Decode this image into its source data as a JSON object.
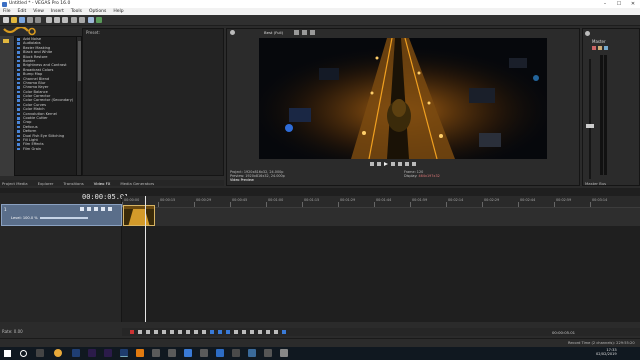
{
  "window": {
    "title": "Untitled * - VEGAS Pro 16.0",
    "controls": [
      "–",
      "☐",
      "✕"
    ]
  },
  "menu": [
    "File",
    "Edit",
    "View",
    "Insert",
    "Tools",
    "Options",
    "Help"
  ],
  "explorer": {
    "presets_label": "Preset:",
    "effects": [
      "Add Noise",
      "Audiolabs",
      "Bezier Masking",
      "Black and White",
      "Block Restore",
      "Border",
      "Brightness and Contrast",
      "Broadcast Colors",
      "Bump Map",
      "Channel Blend",
      "Chroma Blur",
      "Chroma Keyer",
      "Color Balance",
      "Color Corrector",
      "Color Corrector (Secondary)",
      "Color Curves",
      "Color Match",
      "Convolution Kernel",
      "Cookie Cutter",
      "Crop",
      "Defocus",
      "Deform",
      "Dual Fish Eye Stitching",
      "Fill Light",
      "Film Effects",
      "Film Grain"
    ],
    "tabs": [
      "Project Media",
      "Explorer",
      "Transitions",
      "Video FX",
      "Media Generators"
    ]
  },
  "preview": {
    "mode": "Best (Full)",
    "tab": "Video Preview",
    "project_line": "Project:   1920x816x32, 24.000p",
    "preview_line": "Preview:   1920x816x32, 24.000p",
    "display_line": "Video Preview",
    "frame_label": "Frame:",
    "frame_value": "120",
    "display_label": "Display:",
    "display_value": "464x197x32"
  },
  "mixer": {
    "title": "Master",
    "tab": "Master Bus"
  },
  "timeline": {
    "timecode": "00:00:05.01",
    "track_level": "Level: 100.0 %",
    "track_number": "1",
    "ruler_marks": [
      "00:00:00",
      "00:00:15",
      "00:00:29",
      "00:00:45",
      "00:01:00",
      "00:01:15",
      "00:01:29",
      "00:01:44",
      "00:01:59",
      "00:02:14",
      "00:02:29",
      "00:02:44",
      "00:02:59",
      "00:03:14"
    ]
  },
  "bottom": {
    "rate": "Rate: 0.00",
    "end_time": "00:00:05.01",
    "record_time": "Record Time (2 channels): 229:55:20"
  },
  "taskbar": {
    "time": "17:33",
    "date": "02/02/2019"
  },
  "colors": {
    "accent": "#4a86d9",
    "clip": "#b88a2c",
    "track": "#5a6e8a",
    "taskbar": "#101820"
  }
}
